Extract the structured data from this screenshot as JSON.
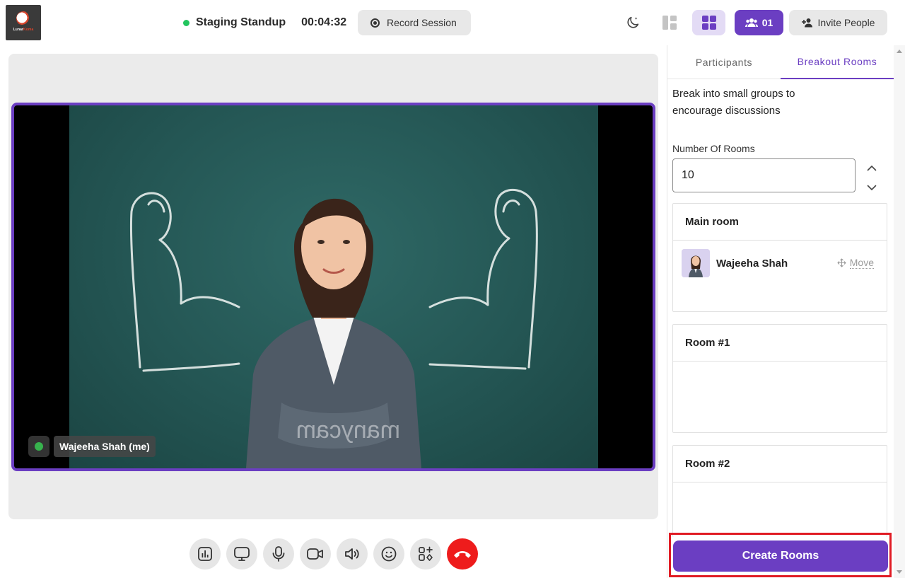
{
  "header": {
    "logo": {
      "brand_prefix": "Lunar",
      "brand_suffix": "Koma",
      "icon": "moon-logo-icon"
    },
    "meeting_title": "Staging Standup",
    "live_color": "#22c55e",
    "timer": "00:04:32",
    "record_label": "Record Session",
    "participant_count": "01",
    "invite_label": "Invite People",
    "icons": [
      "dark-mode-moon-icon",
      "layout-sidebar-icon",
      "layout-grid-icon",
      "participants-icon",
      "add-person-icon"
    ]
  },
  "video": {
    "participant_label": "Wajeeha Shah (me)",
    "signal_icon": "network-signal-icon",
    "active_border_color": "#6b3ec2"
  },
  "toolbar": {
    "items": [
      "polls-icon",
      "screen-share-icon",
      "microphone-icon",
      "camera-icon",
      "speaker-icon",
      "emoji-icon",
      "apps-icon",
      "end-call-icon"
    ]
  },
  "panel": {
    "tabs": [
      "Participants",
      "Breakout Rooms"
    ],
    "active_tab": "Breakout Rooms",
    "intro": "Break into small groups to encourage discussions",
    "rooms_label": "Number Of Rooms",
    "rooms_value": "10",
    "rooms": [
      {
        "title": "Main room",
        "members": [
          {
            "name": "Wajeeha Shah",
            "action": "Move"
          }
        ]
      },
      {
        "title": "Room #1",
        "members": []
      },
      {
        "title": "Room #2",
        "members": []
      }
    ],
    "create_label": "Create Rooms"
  },
  "colors": {
    "accent": "#6b3ec2",
    "end_call": "#ee1c1c",
    "highlight": "#e01b24"
  }
}
